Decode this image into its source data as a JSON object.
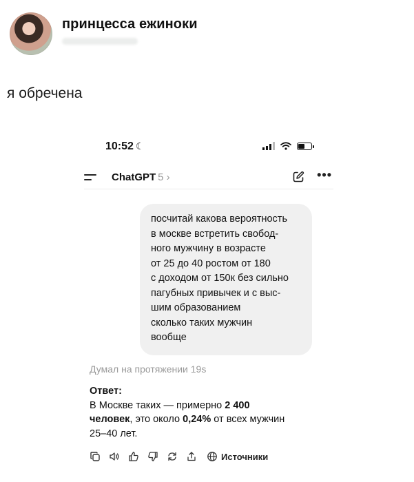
{
  "post": {
    "author_name": "принцесса ежиноки",
    "text": "я обречена"
  },
  "phone": {
    "time": "10:52",
    "battery_level": 0.45
  },
  "chat": {
    "title": "ChatGPT",
    "version": "5",
    "user_message_lines": [
      "посчитай какова вероятность",
      "в москве встретить свобод-",
      "ного мужчину в возрасте",
      "от 25 до 40 ростом от 180",
      "с доходом от 150к без сильно",
      "пагубных привычек и с выс-",
      "шим образованием",
      "сколько таких мужчин",
      "вообще"
    ],
    "thinking_label": "Думал на протяжении 19s",
    "answer": {
      "heading": "Ответ:",
      "line1_a": "В Москве таких — примерно ",
      "line1_b": "2 400",
      "line2_a": "человек",
      "line2_b": ", это около ",
      "line2_c": "0,24%",
      "line2_d": " от всех мужчин",
      "line3": "25–40 лет."
    },
    "actions": {
      "sources_label": "Источники",
      "icons": [
        "copy-icon",
        "speaker-icon",
        "thumbs-up-icon",
        "thumbs-down-icon",
        "regenerate-icon",
        "share-icon",
        "globe-icon"
      ]
    }
  }
}
